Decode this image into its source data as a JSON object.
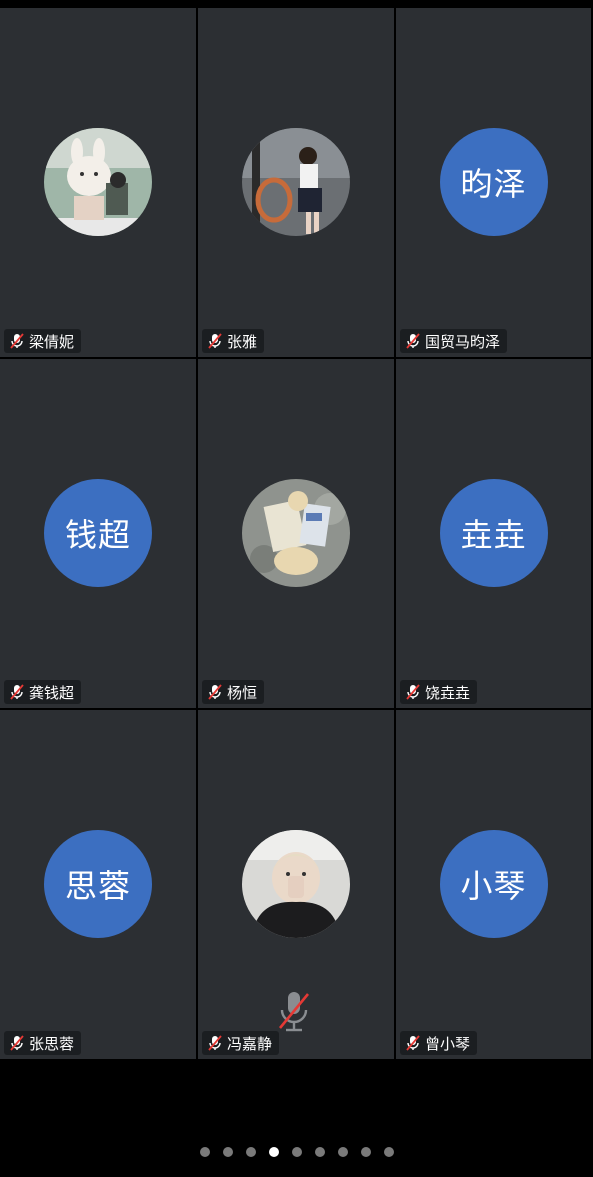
{
  "participants": [
    {
      "name": "梁倩妮",
      "avatar_type": "photo",
      "avatar_desc": "cartoon-bunny-photo",
      "mic": "muted"
    },
    {
      "name": "张雅",
      "avatar_type": "photo",
      "avatar_desc": "girl-photo",
      "mic": "muted"
    },
    {
      "name": "国贸马昀泽",
      "avatar_type": "initials",
      "avatar_text": "昀泽",
      "mic": "muted"
    },
    {
      "name": "龚钱超",
      "avatar_type": "initials",
      "avatar_text": "钱超",
      "mic": "muted"
    },
    {
      "name": "杨恒",
      "avatar_type": "photo",
      "avatar_desc": "cartoon-cat-newspaper-photo",
      "mic": "muted"
    },
    {
      "name": "饶垚垚",
      "avatar_type": "initials",
      "avatar_text": "垚垚",
      "mic": "muted"
    },
    {
      "name": "张思蓉",
      "avatar_type": "initials",
      "avatar_text": "思蓉",
      "mic": "muted"
    },
    {
      "name": "冯嘉静",
      "avatar_type": "photo",
      "avatar_desc": "person-photo",
      "mic": "muted"
    },
    {
      "name": "曾小琴",
      "avatar_type": "initials",
      "avatar_text": "小琴",
      "mic": "muted"
    }
  ],
  "pager": {
    "total_pages": 9,
    "current_page": 4
  },
  "colors": {
    "tile_bg": "#2c2f33",
    "initials_avatar_bg": "#3c6fc1",
    "mute_slash": "#e53935",
    "page_bg": "#000000"
  },
  "icons": {
    "mic_off": "mic-off-icon",
    "center_mic": "mic-muted-icon"
  }
}
